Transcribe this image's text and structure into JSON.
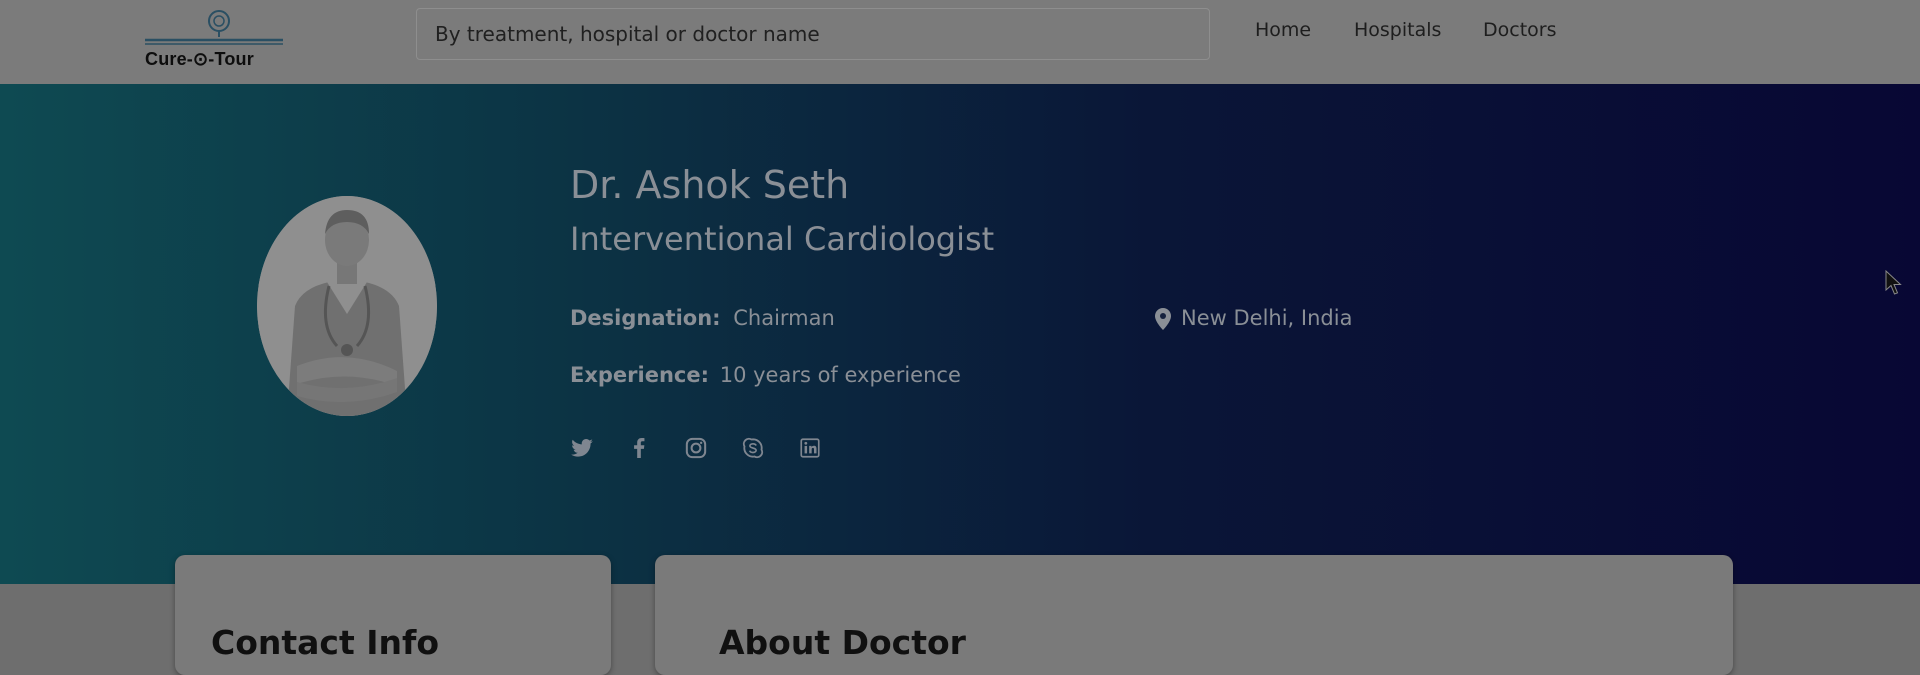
{
  "brand": {
    "logo_text": "Cure-⊙-Tour"
  },
  "search": {
    "placeholder": "By treatment, hospital or doctor name"
  },
  "nav": {
    "items": [
      "Home",
      "Hospitals",
      "Doctors"
    ]
  },
  "doctor": {
    "name": "Dr. Ashok Seth",
    "specialty": "Interventional Cardiologist",
    "designation_label": "Designation:",
    "designation_value": "Chairman",
    "experience_label": "Experience:",
    "experience_value": "10 years of experience",
    "location": "New Delhi, India"
  },
  "social": [
    "twitter-icon",
    "facebook-icon",
    "instagram-icon",
    "skype-icon",
    "linkedin-icon"
  ],
  "sections": {
    "contact_title": "Contact Info",
    "about_title": "About Doctor"
  },
  "colors": {
    "hero_start": "#0e4a52",
    "hero_end": "#080734",
    "overlay_text": "#8a8f96"
  }
}
